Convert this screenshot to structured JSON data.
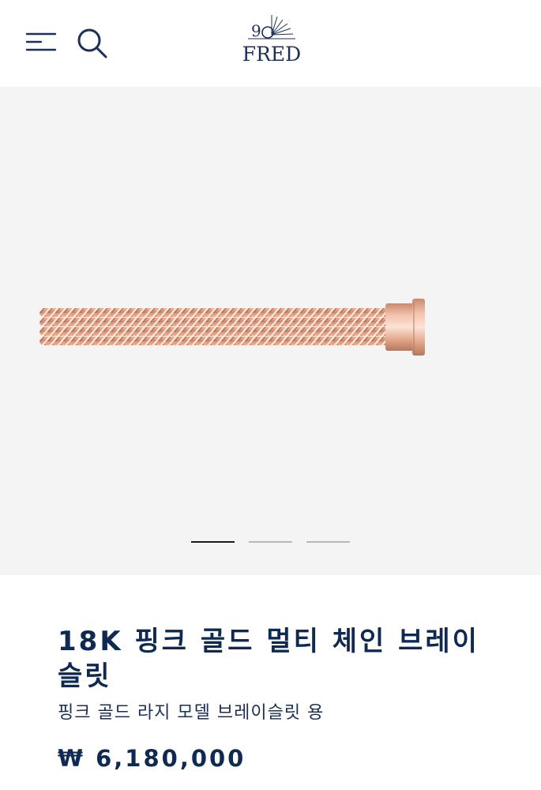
{
  "header": {
    "menu_icon": "hamburger-menu-icon",
    "search_icon": "search-icon",
    "logo": {
      "text": "FRED",
      "emblem": "90",
      "color": "#1c2f5a"
    }
  },
  "gallery": {
    "background": "#f4f4f4",
    "image": "rose-gold-multi-chain-bracelet-cable",
    "slides_count": 3,
    "active_slide": 1
  },
  "product": {
    "title": "18K 핑크 골드 멀티 체인 브레이슬릿",
    "subtitle": "핑크 골드 라지 모델 브레이슬릿 용",
    "price": "₩ 6,180,000"
  },
  "colors": {
    "brand_navy": "#0e2a52",
    "rose_gold": "#e3a58a"
  }
}
